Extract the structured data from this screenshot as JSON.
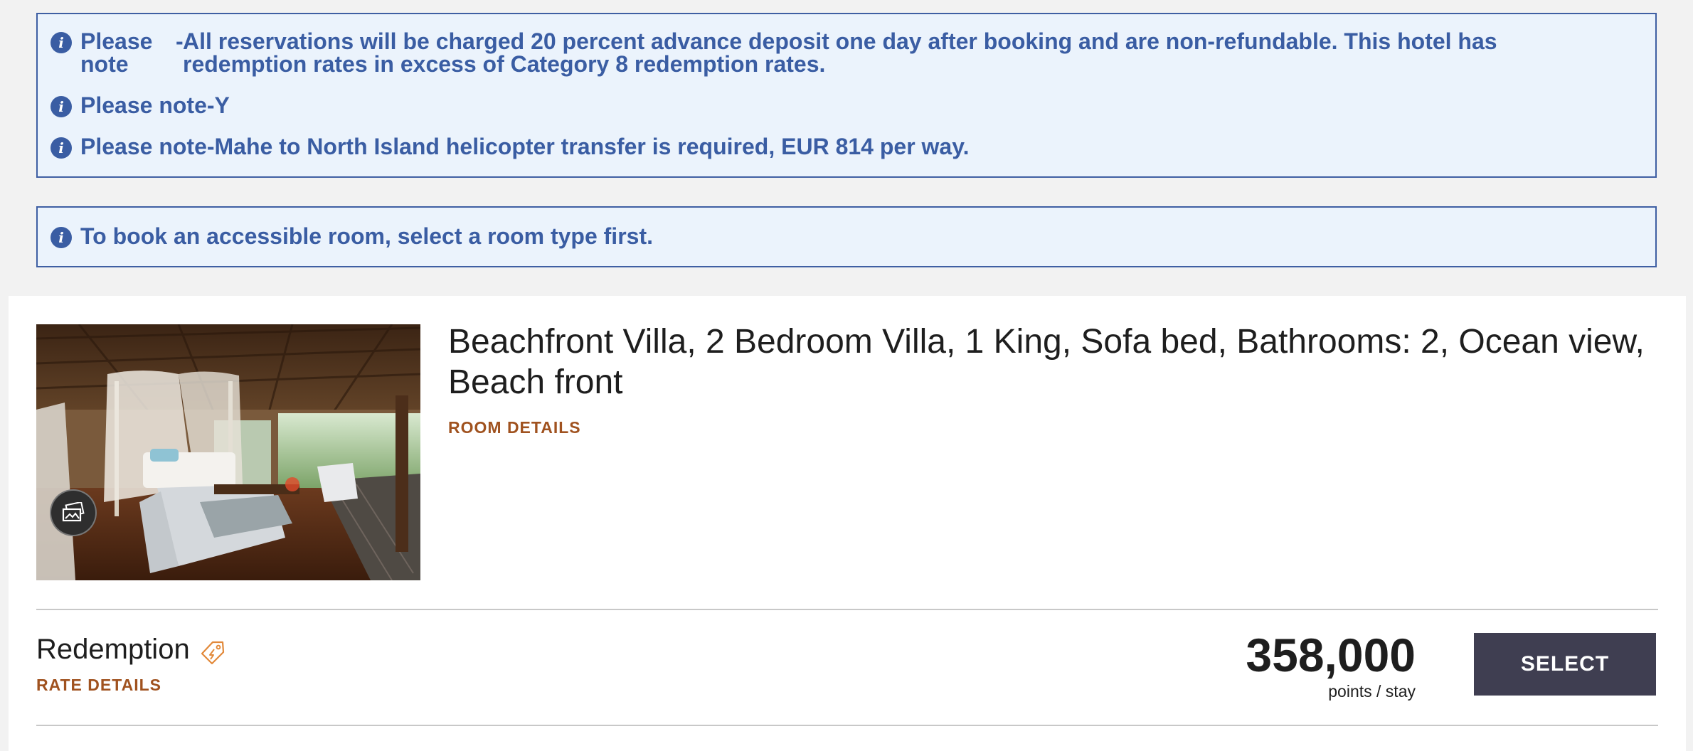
{
  "notices": {
    "note_1": {
      "label": "Please note",
      "dash": "-",
      "text": "All reservations will be charged 20 percent advance deposit one day after booking and are non-refundable. This hotel has redemption rates in excess of Category 8 redemption rates."
    },
    "note_2": {
      "text": "Please note-Y"
    },
    "note_3": {
      "text": "Please note-Mahe to North Island helicopter transfer is required, EUR 814 per way."
    },
    "accessible": {
      "text": "To book an accessible room, select a room type first."
    },
    "icon": "info-icon",
    "icon_glyph": "i",
    "colors": {
      "text": "#3a5da3",
      "background": "#ebf3fc",
      "border": "#3f5fa3"
    }
  },
  "room": {
    "title": "Beachfront Villa, 2 Bedroom Villa, 1 King, Sofa bed, Bathrooms: 2, Ocean view, Beach front",
    "details_link": "ROOM DETAILS",
    "photo_alt": "Villa bedroom with canopy bed",
    "gallery_icon": "photo-gallery-icon"
  },
  "rate": {
    "name": "Redemption",
    "tag_icon": "tag-icon",
    "details_link": "RATE DETAILS",
    "points": "358,000",
    "unit": "points / stay",
    "select_label": "SELECT"
  },
  "colors": {
    "link": "#a0521f",
    "button": "#3f3e51"
  }
}
